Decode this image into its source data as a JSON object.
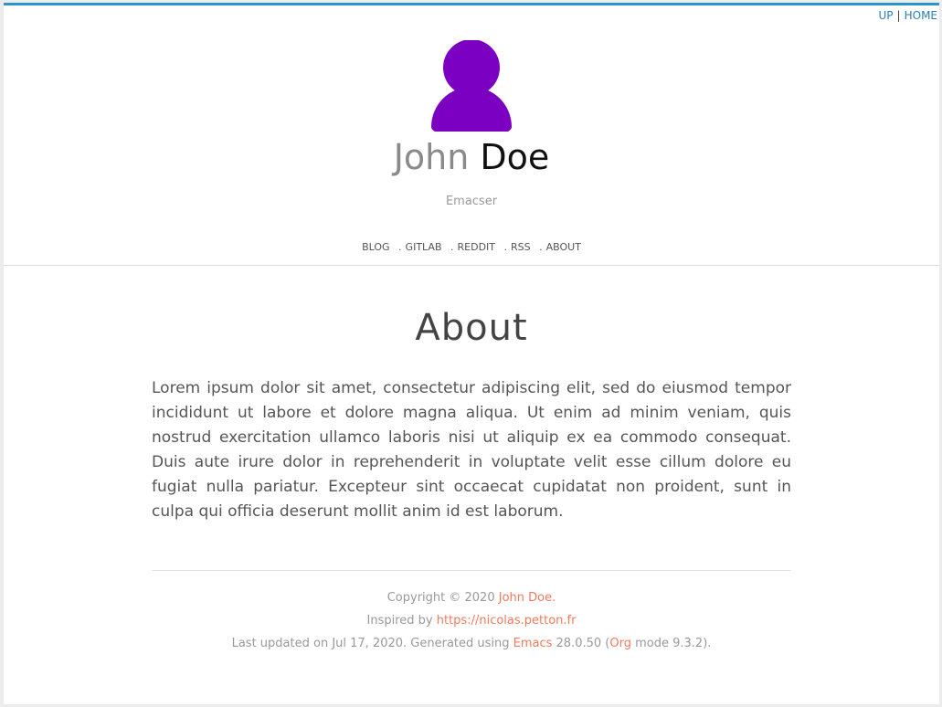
{
  "topnav": {
    "up": "UP",
    "sep": "|",
    "home": "HOME"
  },
  "profile": {
    "first_name": "John",
    "last_name": "Doe",
    "tagline": "Emacser",
    "avatar_color": "#7b00c2"
  },
  "mainnav": {
    "items": [
      "BLOG",
      "GITLAB",
      "REDDIT",
      "RSS",
      "ABOUT"
    ],
    "dot": "."
  },
  "page": {
    "title": "About",
    "body": "Lorem ipsum dolor sit amet, consectetur adipiscing elit, sed do eiusmod tempor incididunt ut labore et dolore magna aliqua. Ut enim ad minim veniam, quis nostrud exercitation ullamco laboris nisi ut aliquip ex ea commodo consequat. Duis aute irure dolor in reprehenderit in voluptate velit esse cillum dolore eu fugiat nulla pariatur. Excepteur sint occaecat cupidatat non proident, sunt in culpa qui officia deserunt mollit anim id est laborum."
  },
  "footer": {
    "copyright_prefix": "Copyright © 2020 ",
    "copyright_link": "John Doe.",
    "inspired_prefix": "Inspired by ",
    "inspired_link": "https://nicolas.petton.fr",
    "updated_prefix": "Last updated on Jul 17, 2020. Generated using ",
    "emacs_link": "Emacs",
    "emacs_version": " 28.0.50 (",
    "org_link": "Org",
    "org_suffix": " mode 9.3.2)."
  }
}
